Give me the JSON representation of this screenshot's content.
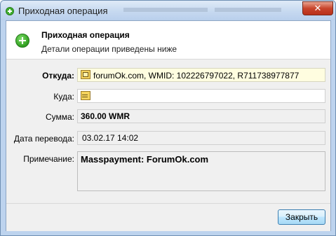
{
  "window": {
    "title": "Приходная операция",
    "close_glyph": "✕"
  },
  "header": {
    "title": "Приходная операция",
    "subtitle": "Детали операции приведены ниже",
    "icon": "plus-circle-icon"
  },
  "fields": {
    "from_label": "Откуда:",
    "from_value": "forumOk.com, WMID: 102226797022, R711738977877",
    "to_label": "Куда:",
    "to_value": "",
    "amount_label": "Сумма:",
    "amount_value": "360.00 WMR",
    "date_label": "Дата перевода:",
    "date_value": "03.02.17 14:02",
    "note_label": "Примечание:",
    "note_value": "Masspayment: ForumOk.com"
  },
  "footer": {
    "close_label": "Закрыть"
  },
  "colors": {
    "frame": "#bdd3ee",
    "highlight_field": "#fffde0",
    "close_titlebar": "#c8452c",
    "accent_green": "#2f9d1e"
  }
}
